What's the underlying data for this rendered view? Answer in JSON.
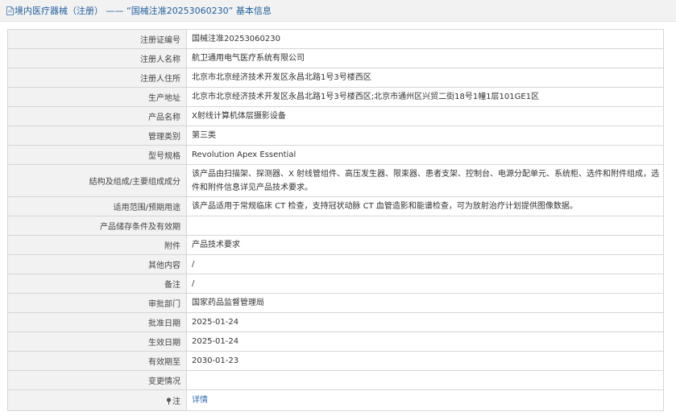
{
  "header": {
    "icon": "document-icon",
    "title": "境内医疗器械（注册） —— “国械注准20253060230” 基本信息"
  },
  "rows": [
    {
      "label": "注册证编号",
      "value": "国械注准20253060230"
    },
    {
      "label": "注册人名称",
      "value": "航卫通用电气医疗系统有限公司"
    },
    {
      "label": "注册人住所",
      "value": "北京市北京经济技术开发区永昌北路1号3号楼西区"
    },
    {
      "label": "生产地址",
      "value": "北京市北京经济技术开发区永昌北路1号3号楼西区;北京市通州区兴贸二街18号1幢1层101GE1区"
    },
    {
      "label": "产品名称",
      "value": "X射线计算机体层摄影设备"
    },
    {
      "label": "管理类别",
      "value": "第三类"
    },
    {
      "label": "型号规格",
      "value": "Revolution Apex Essential"
    },
    {
      "label": "结构及组成/主要组成成分",
      "value": "该产品由扫描架、探测器、X 射线管组件、高压发生器、限束器、患者支架、控制台、电源分配单元、系统柜、选件和附件组成，选件和附件信息详见产品技术要求。"
    },
    {
      "label": "适用范围/预期用途",
      "value": "该产品适用于常规临床 CT 检查，支持冠状动脉 CT 血管造影和能谱检查，可为放射治疗计划提供图像数据。"
    },
    {
      "label": "产品储存条件及有效期",
      "value": ""
    },
    {
      "label": "附件",
      "value": "产品技术要求"
    },
    {
      "label": "其他内容",
      "value": "/"
    },
    {
      "label": "备注",
      "value": "/"
    },
    {
      "label": "审批部门",
      "value": "国家药品监督管理局"
    },
    {
      "label": "批准日期",
      "value": "2025-01-24"
    },
    {
      "label": "生效日期",
      "value": "2025-01-24"
    },
    {
      "label": "有效期至",
      "value": "2030-01-23"
    },
    {
      "label": "变更情况",
      "value": ""
    }
  ],
  "note": {
    "icon": "pin-icon",
    "label": "注",
    "link_text": "详情"
  },
  "colors": {
    "header_text": "#1d5e9e",
    "label_bg": "#f2f2f2",
    "border": "#d6d6d6",
    "link": "#2f6db5"
  }
}
